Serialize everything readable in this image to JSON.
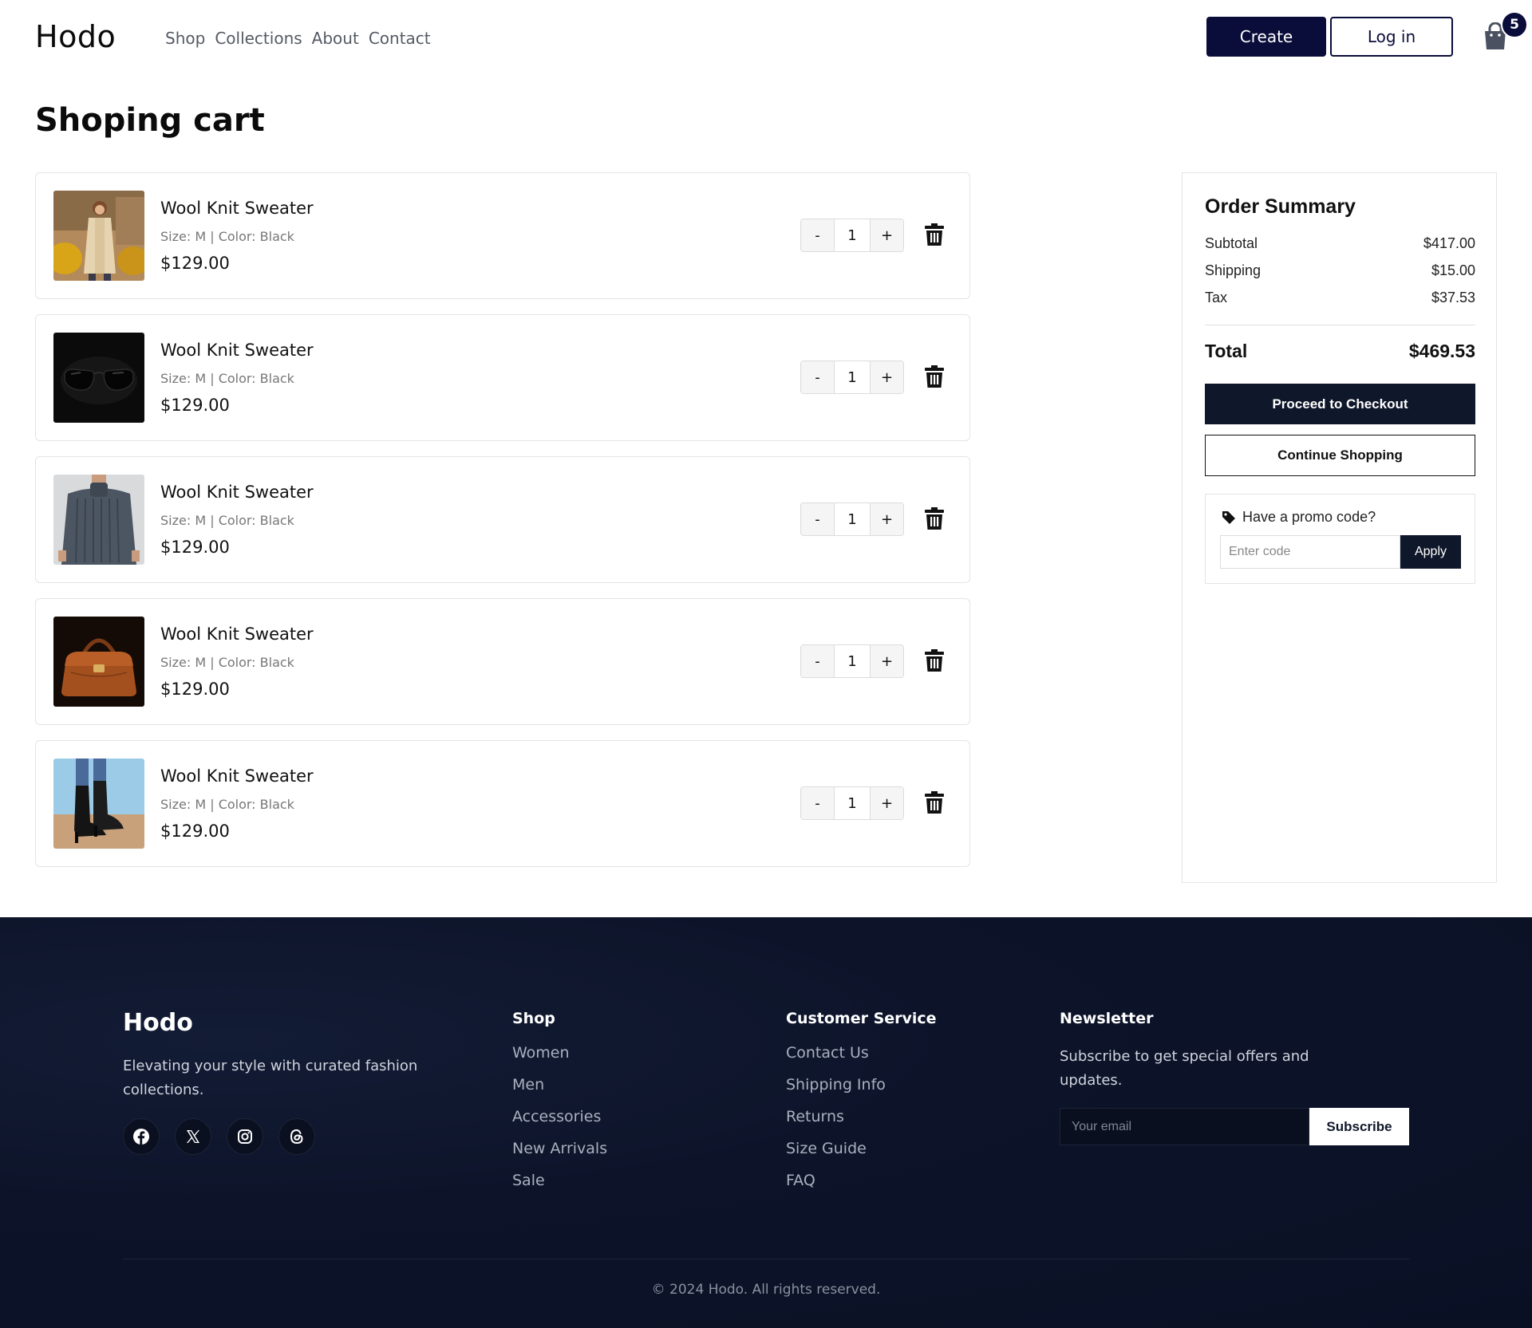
{
  "header": {
    "logo": "Hodo",
    "nav": [
      "Shop",
      "Collections",
      "About",
      "Contact"
    ],
    "create_label": "Create",
    "login_label": "Log in",
    "cart_count": "5"
  },
  "page": {
    "title": "Shoping cart"
  },
  "cart": {
    "items": [
      {
        "name": "Wool Knit Sweater",
        "meta": "Size: M | Color: Black",
        "price": "$129.00",
        "qty": "1",
        "image": "woman-in-beige-coat"
      },
      {
        "name": "Wool Knit Sweater",
        "meta": "Size: M | Color: Black",
        "price": "$129.00",
        "qty": "1",
        "image": "black-sunglasses"
      },
      {
        "name": "Wool Knit Sweater",
        "meta": "Size: M | Color: Black",
        "price": "$129.00",
        "qty": "1",
        "image": "man-in-grey-sweater"
      },
      {
        "name": "Wool Knit Sweater",
        "meta": "Size: M | Color: Black",
        "price": "$129.00",
        "qty": "1",
        "image": "brown-leather-bag"
      },
      {
        "name": "Wool Knit Sweater",
        "meta": "Size: M | Color: Black",
        "price": "$129.00",
        "qty": "1",
        "image": "black-heeled-boots"
      }
    ],
    "minus_label": "-",
    "plus_label": "+",
    "delete_icon": "trash-icon"
  },
  "summary": {
    "title": "Order Summary",
    "rows": [
      {
        "label": "Subtotal",
        "value": "$417.00"
      },
      {
        "label": "Shipping",
        "value": "$15.00"
      },
      {
        "label": "Tax",
        "value": "$37.53"
      }
    ],
    "total_label": "Total",
    "total_value": "$469.53",
    "checkout_label": "Proceed to Checkout",
    "continue_label": "Continue Shopping",
    "promo_label": "Have a promo code?",
    "promo_placeholder": "Enter code",
    "apply_label": "Apply"
  },
  "footer": {
    "logo": "Hodo",
    "description": "Elevating your style with curated fashion collections.",
    "social": [
      "facebook-icon",
      "x-icon",
      "instagram-icon",
      "threads-icon"
    ],
    "columns": [
      {
        "title": "Shop",
        "links": [
          "Women",
          "Men",
          "Accessories",
          "New Arrivals",
          "Sale"
        ]
      },
      {
        "title": "Customer Service",
        "links": [
          "Contact Us",
          "Shipping Info",
          "Returns",
          "Size Guide",
          "FAQ"
        ]
      }
    ],
    "newsletter": {
      "title": "Newsletter",
      "description": "Subscribe to get special offers and updates.",
      "placeholder": "Your email",
      "button": "Subscribe"
    },
    "copyright": "© 2024 Hodo. All rights reserved."
  },
  "colors": {
    "primary": "#0a0c3a",
    "dark": "#0f172a",
    "footer_bg": "#0d142a"
  }
}
